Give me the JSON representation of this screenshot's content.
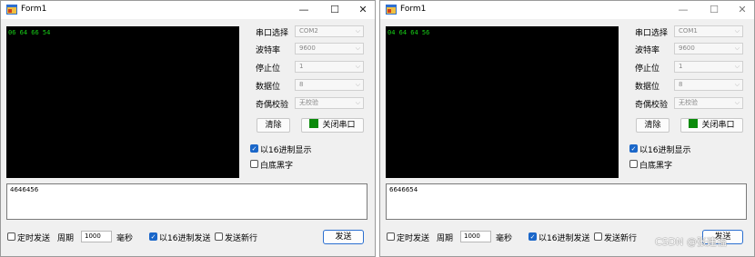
{
  "windows": [
    {
      "title": "Form1",
      "terminal_text": "06 64 66 54",
      "port_label": "串口选择",
      "port_value": "COM2",
      "baud_label": "波特率",
      "baud_value": "9600",
      "stop_label": "停止位",
      "stop_value": "1",
      "data_label": "数据位",
      "data_value": "8",
      "parity_label": "奇偶校验",
      "parity_value": "无校验",
      "clear_label": "清除",
      "close_port_label": "关闭串口",
      "hex_display_label": "以16进制显示",
      "white_bg_label": "白底黑字",
      "send_text": "4646456",
      "timed_send_label": "定时发送",
      "period_label": "周期",
      "period_value": "1000",
      "ms_label": "毫秒",
      "hex_send_label": "以16进制发送",
      "newline_label": "发送新行",
      "send_label": "发送"
    },
    {
      "title": "Form1",
      "terminal_text": "04 64 64 56",
      "port_label": "串口选择",
      "port_value": "COM1",
      "baud_label": "波特率",
      "baud_value": "9600",
      "stop_label": "停止位",
      "stop_value": "1",
      "data_label": "数据位",
      "data_value": "8",
      "parity_label": "奇偶校验",
      "parity_value": "无校验",
      "clear_label": "清除",
      "close_port_label": "关闭串口",
      "hex_display_label": "以16进制显示",
      "white_bg_label": "白底黑字",
      "send_text": "6646654",
      "timed_send_label": "定时发送",
      "period_label": "周期",
      "period_value": "1000",
      "ms_label": "毫秒",
      "hex_send_label": "以16进制发送",
      "newline_label": "发送新行",
      "send_label": "发送"
    }
  ],
  "caption_glyphs": {
    "minimize": "—",
    "maximize": "☐",
    "close": "✕"
  },
  "checkbox_states": {
    "hex_display": true,
    "white_bg": false,
    "timed_send": false,
    "hex_send": true,
    "newline": false
  },
  "watermark": "CSDN @张建福"
}
